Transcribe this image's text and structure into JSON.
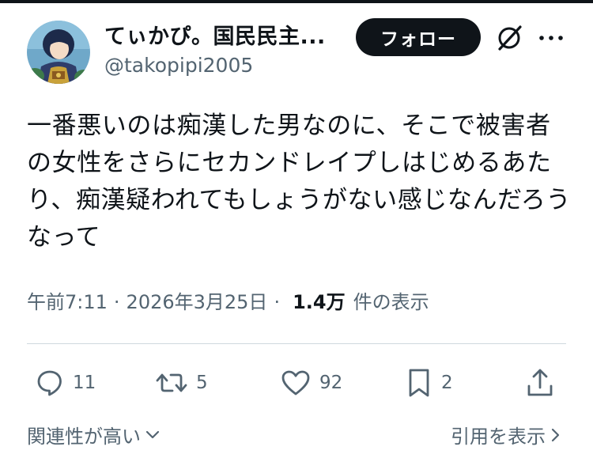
{
  "author": {
    "display_name": "てぃかぴ。国民民主...",
    "handle": "@takopipi2005",
    "avatar_icon": "avatar-illustration"
  },
  "header": {
    "follow_label": "フォロー",
    "grok_icon": "grok-slash-circle-icon",
    "more_icon": "more-dots-icon"
  },
  "tweet": {
    "text": "一番悪いのは痴漢した男なのに、そこで被害者の女性をさらにセカンドレイプしはじめるあたり、痴漢疑われてもしょうがない感じなんだろうなって"
  },
  "meta": {
    "time": "午前7:11",
    "separator": "·",
    "date": "2026年3月25日",
    "views_count": "1.4万",
    "views_label": "件の表示"
  },
  "actions": {
    "reply_count": "11",
    "retweet_count": "5",
    "like_count": "92",
    "bookmark_count": "2"
  },
  "footer": {
    "related_label": "関連性が高い",
    "quotes_label": "引用を表示"
  },
  "colors": {
    "text_primary": "#0f1419",
    "text_secondary": "#536471",
    "divider": "#cfd9de",
    "button_bg": "#0f1419"
  }
}
